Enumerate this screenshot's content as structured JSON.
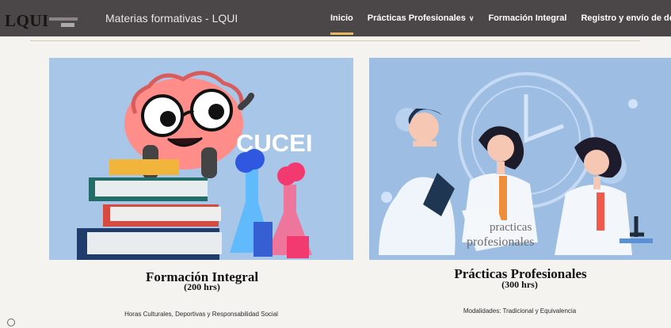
{
  "header": {
    "logo_text": "LQUI",
    "site_title": "Materias formativas - LQUI",
    "nav": [
      {
        "label": "Inicio",
        "active": true
      },
      {
        "label": "Prácticas Profesionales",
        "has_dropdown": true
      },
      {
        "label": "Formación Integral"
      },
      {
        "label": "Registro y envío de docum"
      }
    ]
  },
  "cards": [
    {
      "image_text": "CUCEI",
      "title": "Formación Integral",
      "hours": "(200 hrs)",
      "description": "Horas Culturales, Deportivas y Responsabilidad Social"
    },
    {
      "image_text_line1": "practicas",
      "image_text_line2": "profesionales",
      "title": "Prácticas Profesionales",
      "hours": "(300 hrs)",
      "description": "Modalidades: Tradicional y Equivalencia"
    }
  ],
  "icons": {
    "dropdown": "chevron-down-icon",
    "corner": "circle-icon"
  },
  "colors": {
    "header_bg": "#4b4647",
    "active_underline": "#e6b85b",
    "page_bg": "#f5f3ef"
  }
}
